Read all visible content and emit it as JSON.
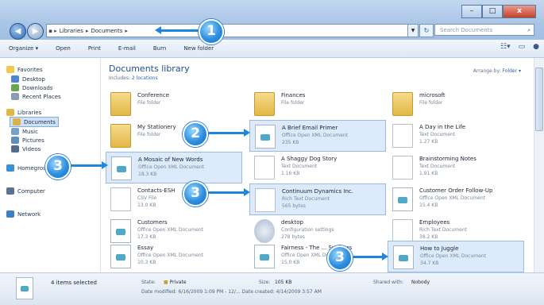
{
  "window": {
    "minimize": "–",
    "maximize": "□",
    "close": "x"
  },
  "address": {
    "crumbs": [
      "Libraries",
      "Documents"
    ],
    "search_placeholder": "Search Documents"
  },
  "toolbar": {
    "items": [
      "Organize ▾",
      "Open",
      "Print",
      "E-mail",
      "Burn",
      "New folder"
    ]
  },
  "navpane": {
    "favorites": "Favorites",
    "desktop": "Desktop",
    "downloads": "Downloads",
    "recent": "Recent Places",
    "libraries": "Libraries",
    "documents": "Documents",
    "music": "Music",
    "pictures": "Pictures",
    "videos": "Videos",
    "homegroup": "Homegroup",
    "computer": "Computer",
    "network": "Network"
  },
  "library": {
    "title": "Documents library",
    "includes_prefix": "Includes:",
    "includes_link": "2 locations",
    "arrange_label": "Arrange by:",
    "arrange_value": "Folder ▾"
  },
  "files": [
    {
      "name": "Conference",
      "type": "File folder",
      "size": ""
    },
    {
      "name": "Finances",
      "type": "File folder",
      "size": ""
    },
    {
      "name": "microsoft",
      "type": "File folder",
      "size": ""
    },
    {
      "name": "My Stationery",
      "type": "File folder",
      "size": ""
    },
    {
      "name": "A Brief Email Primer",
      "type": "Office Open XML Document",
      "size": "235 KB"
    },
    {
      "name": "A Day in the Life",
      "type": "Text Document",
      "size": "1.27 KB"
    },
    {
      "name": "A Mosaic of New Words",
      "type": "Office Open XML Document",
      "size": "18.3 KB"
    },
    {
      "name": "A Shaggy Dog Story",
      "type": "Text Document",
      "size": "1.16 KB"
    },
    {
      "name": "Brainstorming Notes",
      "type": "Text Document",
      "size": "1.91 KB"
    },
    {
      "name": "Contacts-ESH",
      "type": "CSV File",
      "size": "13.0 KB"
    },
    {
      "name": "Continuum Dynamics Inc.",
      "type": "Rich Text Document",
      "size": "565 bytes"
    },
    {
      "name": "Customer Order Follow-Up",
      "type": "Office Open XML Document",
      "size": "15.4 KB"
    },
    {
      "name": "Customers",
      "type": "Office Open XML Document",
      "size": "17.3 KB"
    },
    {
      "name": "desktop",
      "type": "Configuration settings",
      "size": "278 bytes"
    },
    {
      "name": "Employees",
      "type": "Rich Text Document",
      "size": "38.2 KB"
    },
    {
      "name": "Essay",
      "type": "Office Open XML Document",
      "size": "10.3 KB"
    },
    {
      "name": "Fairness - The ... Systems",
      "type": "Office Open XML Document",
      "size": "15.0 KB"
    },
    {
      "name": "How to Juggle",
      "type": "Office Open XML Document",
      "size": "34.7 KB"
    }
  ],
  "details": {
    "summary": "4 items selected",
    "state_label": "State:",
    "state_value": "Private",
    "size_label": "Size:",
    "size_value": "105 KB",
    "shared_label": "Shared with:",
    "shared_value": "Nobody",
    "dates": "Date modified: 6/16/2009 1:09 PM - 12/... Date created: 4/14/2009 3:57 AM"
  },
  "callouts": [
    "1",
    "2",
    "3",
    "3",
    "3"
  ]
}
